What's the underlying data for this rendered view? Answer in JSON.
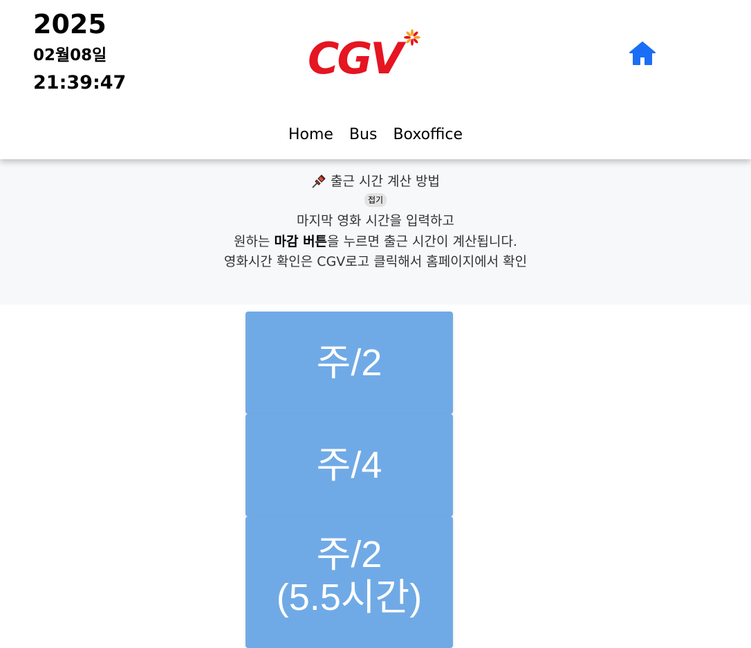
{
  "header": {
    "year": "2025",
    "date": "02월08일",
    "time": "21:39:47",
    "logo_text": "CGV",
    "logo_color": "#e51521",
    "home_icon": "home-icon",
    "home_icon_color": "#1a6ef5"
  },
  "nav": {
    "items": [
      "Home",
      "Bus",
      "Boxoffice"
    ]
  },
  "info": {
    "pin_icon": "pushpin-icon",
    "title": "출근 시간 계산 방법",
    "fold_label": "접기",
    "line1": "마지막 영화 시간을 입력하고",
    "line2_pre": "원하는 ",
    "line2_bold": "마감 버튼",
    "line2_post": "을 누르면 출근 시간이 계산됩니다.",
    "line3": "영화시간 확인은 CGV로고 클릭해서 홈페이지에서 확인"
  },
  "buttons": [
    {
      "label": "주/2"
    },
    {
      "label": "주/4"
    },
    {
      "label": "주/2",
      "sub": "(5.5시간)"
    }
  ],
  "colors": {
    "button_bg": "#70aae6",
    "info_bg": "#f7f8fa"
  }
}
